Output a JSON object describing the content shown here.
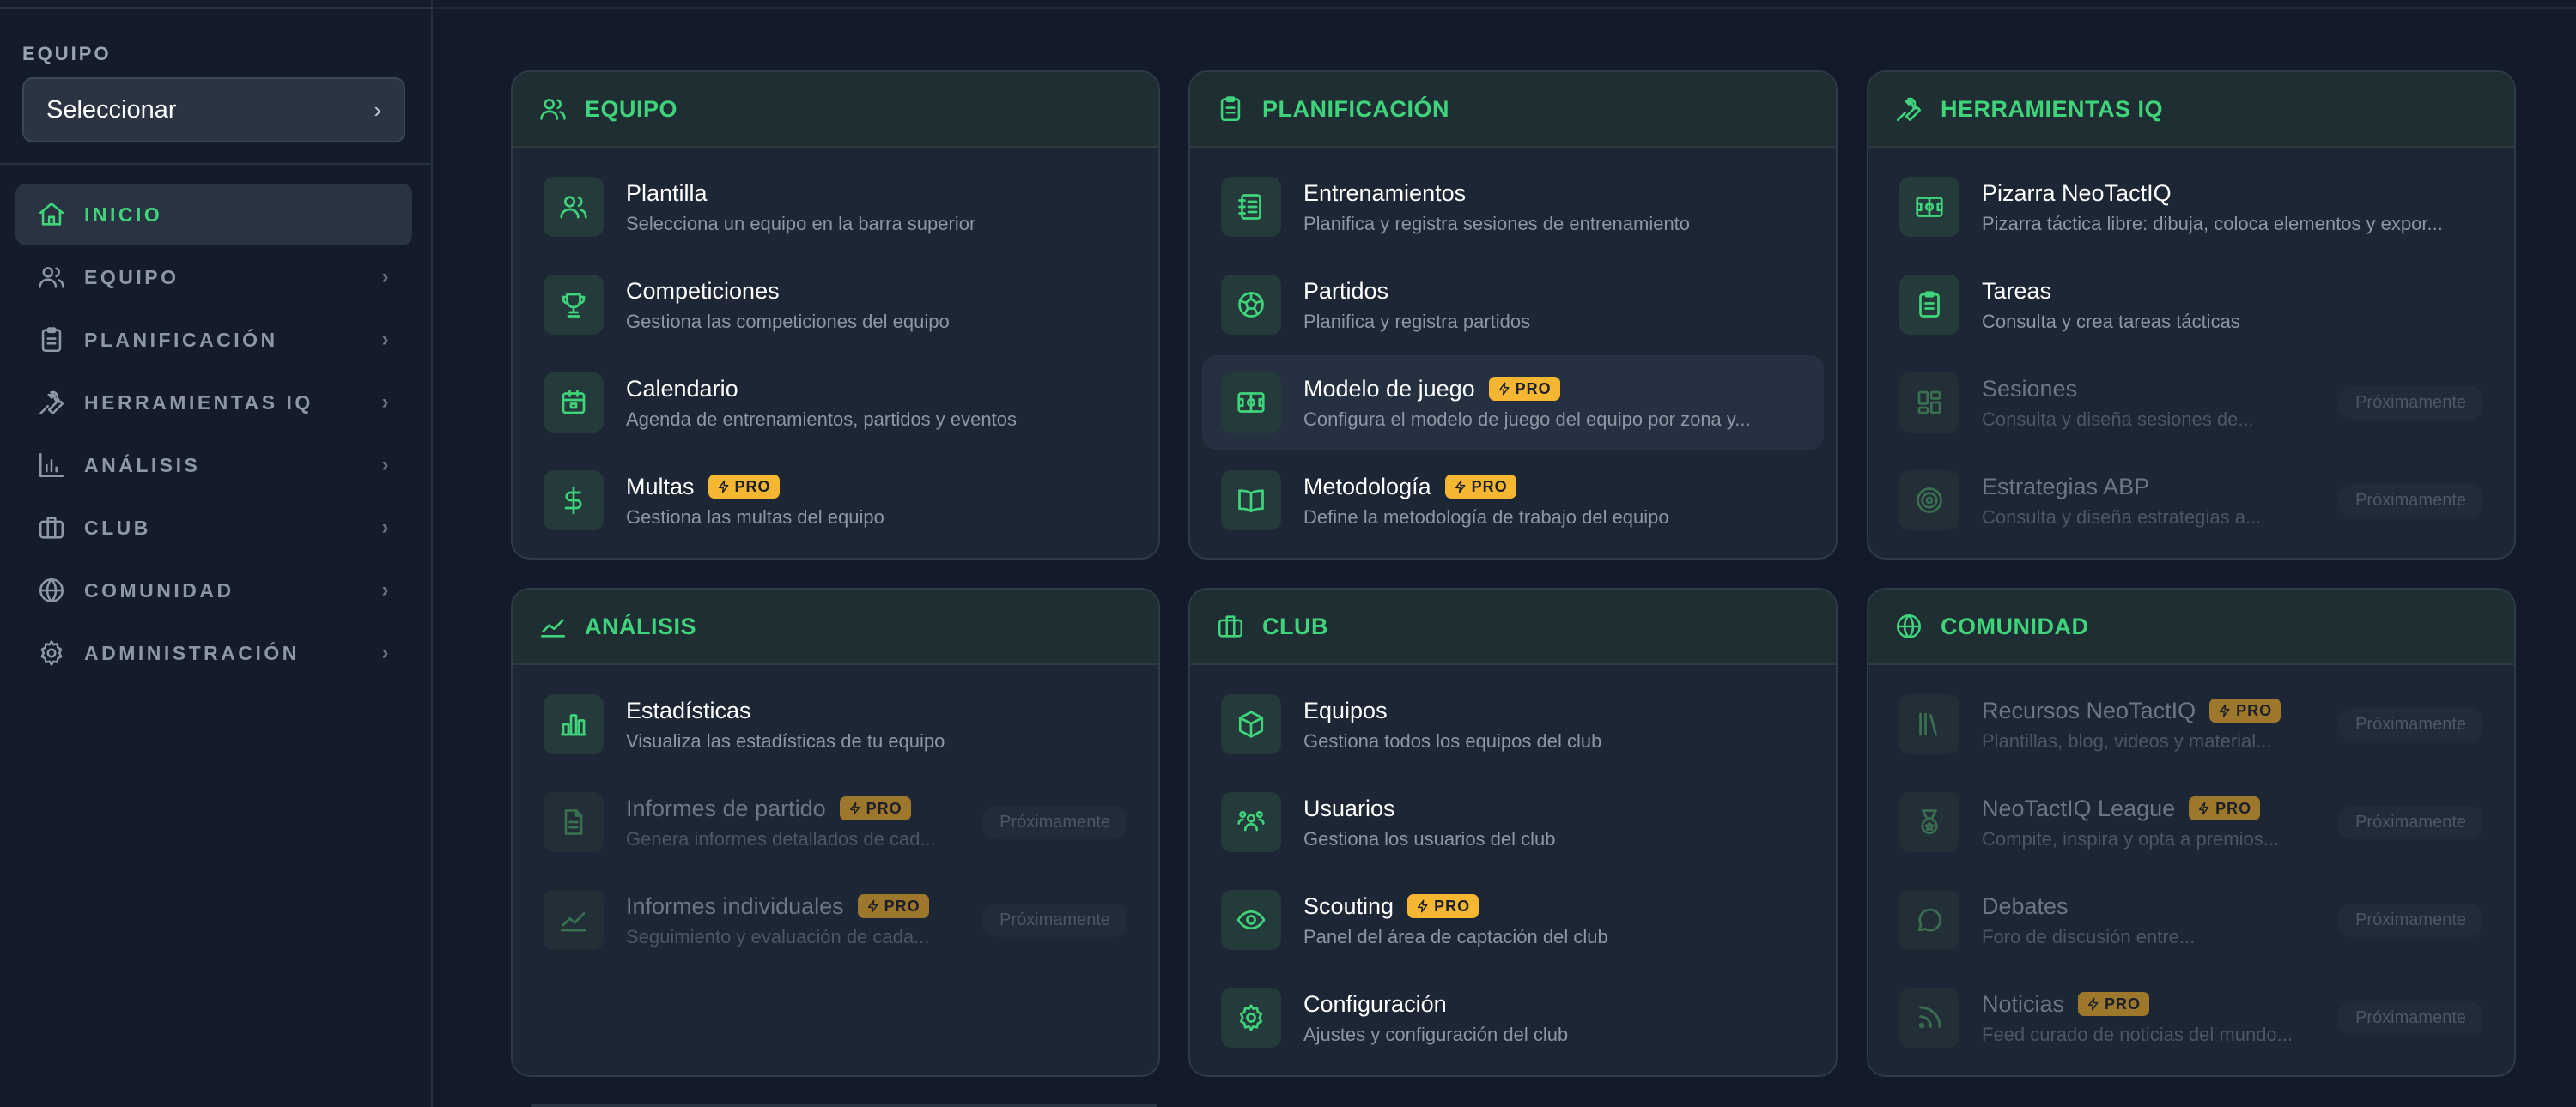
{
  "sidebar": {
    "team_label": "EQUIPO",
    "team_select": "Seleccionar",
    "nav": [
      {
        "label": "INICIO",
        "icon": "home-icon",
        "active": true
      },
      {
        "label": "EQUIPO",
        "icon": "users-icon"
      },
      {
        "label": "PLANIFICACIÓN",
        "icon": "clipboard-icon"
      },
      {
        "label": "HERRAMIENTAS IQ",
        "icon": "wrench-icon"
      },
      {
        "label": "ANÁLISIS",
        "icon": "bar-chart-icon"
      },
      {
        "label": "CLUB",
        "icon": "briefcase-icon"
      },
      {
        "label": "COMUNIDAD",
        "icon": "globe-icon"
      },
      {
        "label": "ADMINISTRACIÓN",
        "icon": "gear-icon"
      }
    ]
  },
  "badges": {
    "pro": "PRO",
    "soon": "Próximamente"
  },
  "colors": {
    "accent": "#3fd37b",
    "pro": "#f5b731",
    "background": "#131b2a",
    "card": "#1d2635"
  },
  "cards": {
    "equipo": {
      "title": "EQUIPO",
      "items": [
        {
          "title": "Plantilla",
          "desc": "Selecciona un equipo en la barra superior"
        },
        {
          "title": "Competiciones",
          "desc": "Gestiona las competiciones del equipo"
        },
        {
          "title": "Calendario",
          "desc": "Agenda de entrenamientos, partidos y eventos"
        },
        {
          "title": "Multas",
          "desc": "Gestiona las multas del equipo"
        }
      ]
    },
    "planificacion": {
      "title": "PLANIFICACIÓN",
      "items": [
        {
          "title": "Entrenamientos",
          "desc": "Planifica y registra sesiones de entrenamiento"
        },
        {
          "title": "Partidos",
          "desc": "Planifica y registra partidos"
        },
        {
          "title": "Modelo de juego",
          "desc": "Configura el modelo de juego del equipo por zona y..."
        },
        {
          "title": "Metodología",
          "desc": "Define la metodología de trabajo del equipo"
        }
      ]
    },
    "herramientas": {
      "title": "HERRAMIENTAS IQ",
      "items": [
        {
          "title": "Pizarra NeoTactIQ",
          "desc": "Pizarra táctica libre: dibuja, coloca elementos y expor..."
        },
        {
          "title": "Tareas",
          "desc": "Consulta y crea tareas tácticas"
        },
        {
          "title": "Sesiones",
          "desc": "Consulta y diseña sesiones de..."
        },
        {
          "title": "Estrategias ABP",
          "desc": "Consulta y diseña estrategias a..."
        }
      ]
    },
    "analisis": {
      "title": "ANÁLISIS",
      "items": [
        {
          "title": "Estadísticas",
          "desc": "Visualiza las estadísticas de tu equipo"
        },
        {
          "title": "Informes de partido",
          "desc": "Genera informes detallados de cad..."
        },
        {
          "title": "Informes individuales",
          "desc": "Seguimiento y evaluación de cada..."
        }
      ]
    },
    "club": {
      "title": "CLUB",
      "items": [
        {
          "title": "Equipos",
          "desc": "Gestiona todos los equipos del club"
        },
        {
          "title": "Usuarios",
          "desc": "Gestiona los usuarios del club"
        },
        {
          "title": "Scouting",
          "desc": "Panel del área de captación del club"
        },
        {
          "title": "Configuración",
          "desc": "Ajustes y configuración del club"
        }
      ]
    },
    "comunidad": {
      "title": "COMUNIDAD",
      "items": [
        {
          "title": "Recursos NeoTactIQ",
          "desc": "Plantillas, blog, videos y material..."
        },
        {
          "title": "NeoTactIQ League",
          "desc": "Compite, inspira y opta a premios..."
        },
        {
          "title": "Debates",
          "desc": "Foro de discusión entre..."
        },
        {
          "title": "Noticias",
          "desc": "Feed curado de noticias del mundo..."
        }
      ]
    }
  }
}
